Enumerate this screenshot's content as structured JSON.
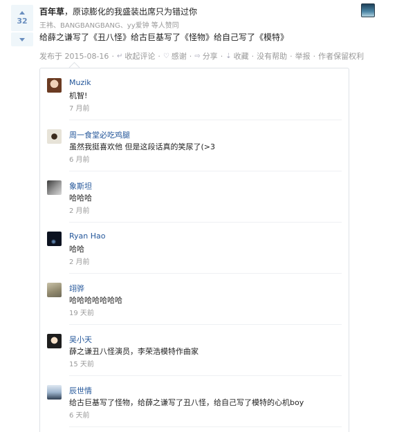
{
  "answer": {
    "vote_count": "32",
    "author_name": "百年草",
    "author_bio": "，原谅膨化的我盛装出席只为错过你",
    "voters_text": "王袆、BANGBANGBANG、yy爱钟 等人赞同",
    "text": "给薛之谦写了《丑八怪》给古巨基写了《怪物》给自己写了《模特》"
  },
  "meta": {
    "date": "发布于 2015-08-16",
    "collapse_comments": "收起评论",
    "thanks": "感谢",
    "share": "分享",
    "favorite": "收藏",
    "no_help": "没有帮助",
    "report": "举报",
    "copyright": "作者保留权利"
  },
  "comments": [
    {
      "name": "Muzik",
      "text": "机智!",
      "time": "7 月前"
    },
    {
      "name": "周一食堂必吃鸡腿",
      "text": "虽然我挺喜欢他 但是这段话真的笑尿了(>3",
      "time": "6 月前"
    },
    {
      "name": "象斯坦",
      "text": "哈哈哈",
      "time": "2 月前"
    },
    {
      "name": "Ryan Hao",
      "text": "哈哈",
      "time": "2 月前"
    },
    {
      "name": "翊骅",
      "text": "哈哈哈哈哈哈哈",
      "time": "19 天前"
    },
    {
      "name": "吴小天",
      "text": "薛之谦丑八怪演员，李荣浩模特作曲家",
      "time": "15 天前"
    },
    {
      "name": "辰世情",
      "text": "给古巨基写了怪物，给薛之谦写了丑八怪，给自己写了模特的心机boy",
      "time": "6 天前"
    }
  ]
}
